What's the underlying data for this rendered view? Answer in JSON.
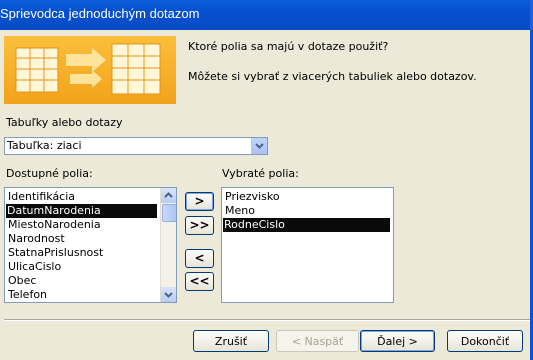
{
  "window": {
    "title": "Sprievodca jednoduchým dotazom"
  },
  "intro": {
    "line1": "Ktoré polia sa majú v dotaze použiť?",
    "line2": "Môžete si vybrať z viacerých tabuliek alebo dotazov."
  },
  "tables": {
    "label": "Tabuľky alebo dotazy",
    "selected": "Tabuľka: ziaci"
  },
  "available": {
    "label": "Dostupné polia:",
    "items": [
      "Identifikácia",
      "DatumNarodenia",
      "MiestoNarodenia",
      "Narodnost",
      "StatnaPrislusnost",
      "UlicaCislo",
      "Obec",
      "Telefon"
    ],
    "selected_index": 1
  },
  "chosen": {
    "label": "Vybraté polia:",
    "items": [
      "Priezvisko",
      "Meno",
      "RodneCislo"
    ],
    "selected_index": 2
  },
  "move_buttons": {
    "add_one": ">",
    "add_all": ">>",
    "remove_one": "<",
    "remove_all": "<<"
  },
  "footer": {
    "cancel": "Zrušiť",
    "back": "< Naspäť",
    "next": "Ďalej >",
    "finish": "Dokončiť"
  },
  "colors": {
    "titlebar": "#0550d0",
    "dialog": "#ece9d8",
    "selection": "#0a0a0a"
  }
}
